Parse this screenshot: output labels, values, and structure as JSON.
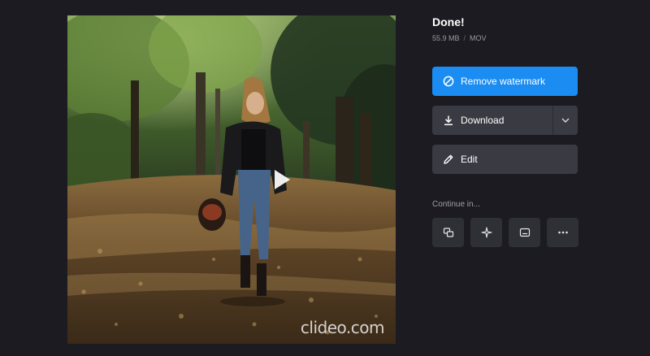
{
  "preview": {
    "watermark_text": "clideo.com",
    "play_icon": "play-icon"
  },
  "result": {
    "title": "Done!",
    "file_size": "55.9 MB",
    "separator": "/",
    "file_format": "MOV"
  },
  "actions": {
    "remove_watermark_label": "Remove watermark",
    "download_label": "Download",
    "edit_label": "Edit"
  },
  "continue": {
    "label": "Continue in...",
    "tools": [
      {
        "icon": "merge-icon"
      },
      {
        "icon": "sparkle-icon"
      },
      {
        "icon": "subtitles-icon"
      },
      {
        "icon": "more-icon"
      }
    ]
  },
  "colors": {
    "background": "#1b1b21",
    "accent": "#1b8cf2",
    "button": "#3a3a42",
    "tool_button": "#2f2f36"
  }
}
